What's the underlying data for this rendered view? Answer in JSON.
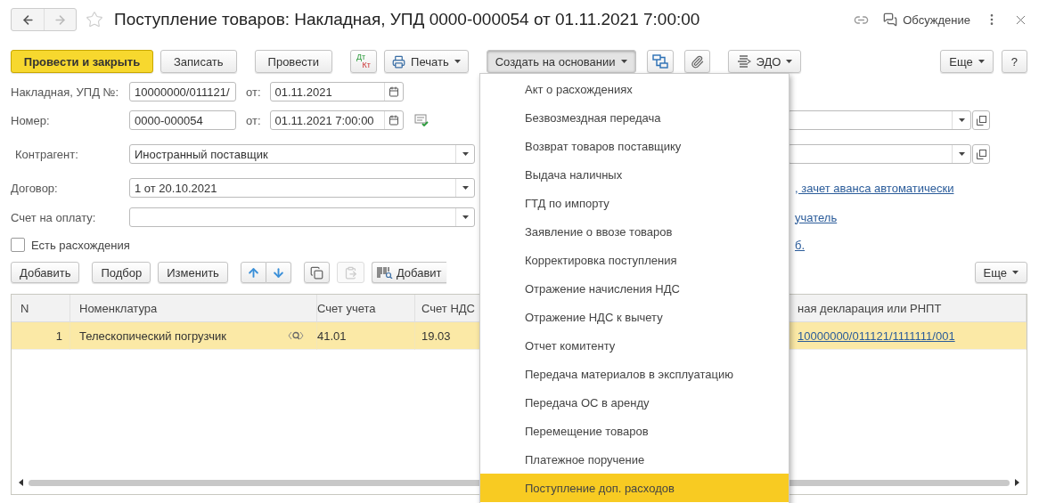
{
  "window": {
    "title": "Поступление товаров: Накладная, УПД 0000-000054 от 01.11.2021 7:00:00",
    "discussion": "Обсуждение"
  },
  "toolbar": {
    "groups": [
      [
        {
          "kind": "primary",
          "label": "Провести и закрыть"
        },
        {
          "kind": "plain",
          "label": "Записать"
        }
      ],
      [
        {
          "kind": "plain",
          "label": "Провести"
        }
      ],
      [
        {
          "kind": "dtkt",
          "top": "Дт",
          "bottom": "Кт"
        },
        {
          "kind": "print",
          "label": "Печать",
          "expanded": false
        }
      ],
      [
        {
          "kind": "menu",
          "label": "Создать на основании",
          "expanded": true
        },
        {
          "kind": "structure"
        },
        {
          "kind": "attach"
        }
      ],
      [
        {
          "kind": "edo",
          "label": "ЭДО",
          "expanded": false
        }
      ]
    ],
    "right": [
      {
        "kind": "menu",
        "label": "Еще",
        "expanded": false
      },
      {
        "kind": "plain",
        "label": "?"
      }
    ]
  },
  "form": {
    "invoice": {
      "label": "Накладная, УПД №:",
      "value": "10000000/011121/",
      "date_label": "от:",
      "date": "01.11.2021"
    },
    "number": {
      "label": "Номер:",
      "value": "0000-000054",
      "date_label": "от:",
      "date": "01.11.2021  7:00:00"
    },
    "counterparty": {
      "label": "Контрагент:",
      "value": "Иностранный поставщик"
    },
    "contract": {
      "label": "Договор:",
      "value": "1 от 20.10.2021",
      "link": ", зачет аванса автоматически"
    },
    "payment_invoice": {
      "label": "Счет на оплату:",
      "link": "учатель"
    },
    "discrepancies": {
      "label": "Есть расхождения",
      "checked": false,
      "link": "б."
    }
  },
  "table_toolbar": {
    "groups": [
      [
        {
          "kind": "plain",
          "label": "Добавить",
          "disabled": false
        }
      ],
      [
        {
          "kind": "plain",
          "label": "Подбор",
          "disabled": false
        },
        {
          "kind": "plain",
          "label": "Изменить",
          "disabled": false
        }
      ],
      [
        {
          "kind": "up",
          "disabled": false
        },
        {
          "kind": "down",
          "disabled": false
        }
      ],
      [
        {
          "kind": "copy",
          "disabled": false
        },
        {
          "kind": "paste",
          "disabled": true
        },
        {
          "kind": "barcode",
          "label": "Добавит",
          "disabled": false
        }
      ]
    ],
    "more": {
      "label": "Еще",
      "expanded": false
    }
  },
  "table": {
    "columns": [
      "N",
      "Номенклатура",
      "Счет учета",
      "Счет НДС",
      "ная декларация или РНПТ"
    ],
    "rows": [
      {
        "cells": [
          "1",
          "Телескопический погрузчик",
          "41.01",
          "19.03",
          "10000000/011121/1111111/001"
        ],
        "selected": true
      }
    ]
  },
  "menu": {
    "items": [
      {
        "label": "Акт о расхождениях",
        "selected": false
      },
      {
        "label": "Безвозмездная передача",
        "selected": false
      },
      {
        "label": "Возврат товаров поставщику",
        "selected": false
      },
      {
        "label": "Выдача наличных",
        "selected": false
      },
      {
        "label": "ГТД по импорту",
        "selected": false
      },
      {
        "label": "Заявление о ввозе товаров",
        "selected": false
      },
      {
        "label": "Корректировка поступления",
        "selected": false
      },
      {
        "label": "Отражение начисления НДС",
        "selected": false
      },
      {
        "label": "Отражение НДС к вычету",
        "selected": false
      },
      {
        "label": "Отчет комитенту",
        "selected": false
      },
      {
        "label": "Передача материалов в эксплуатацию",
        "selected": false
      },
      {
        "label": "Передача ОС в аренду",
        "selected": false
      },
      {
        "label": "Перемещение товаров",
        "selected": false
      },
      {
        "label": "Платежное поручение",
        "selected": false
      },
      {
        "label": "Поступление доп. расходов",
        "selected": true
      }
    ]
  }
}
